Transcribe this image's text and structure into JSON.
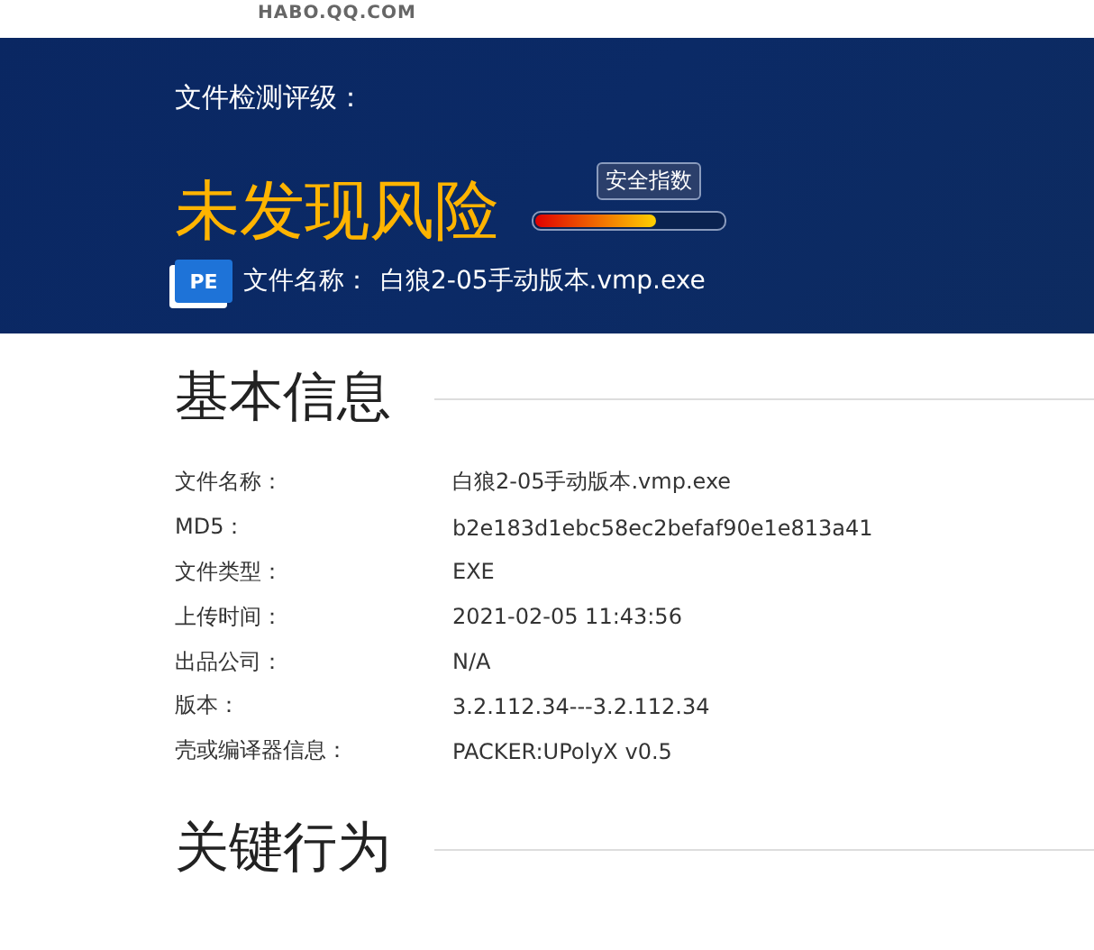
{
  "site": {
    "domain": "HABO.QQ.COM"
  },
  "banner": {
    "rating_label": "文件检测评级：",
    "verdict": "未发现风险",
    "meter": {
      "tooltip": "安全指数",
      "level": 0.64
    },
    "file_badge": "PE",
    "file_label": "文件名称：",
    "file_name": "白狼2-05手动版本.vmp.exe"
  },
  "sections": [
    {
      "title": "基本信息",
      "rows": [
        {
          "label": "文件名称：",
          "value": "白狼2-05手动版本.vmp.exe"
        },
        {
          "label": "MD5：",
          "value": "b2e183d1ebc58ec2befaf90e1e813a41"
        },
        {
          "label": "文件类型：",
          "value": "EXE"
        },
        {
          "label": "上传时间：",
          "value": "2021-02-05 11:43:56"
        },
        {
          "label": "出品公司：",
          "value": "N/A"
        },
        {
          "label": "版本：",
          "value": "3.2.112.34---3.2.112.34"
        },
        {
          "label": "壳或编译器信息：",
          "value": "PACKER:UPolyX v0.5"
        }
      ]
    },
    {
      "title": "关键行为"
    }
  ]
}
